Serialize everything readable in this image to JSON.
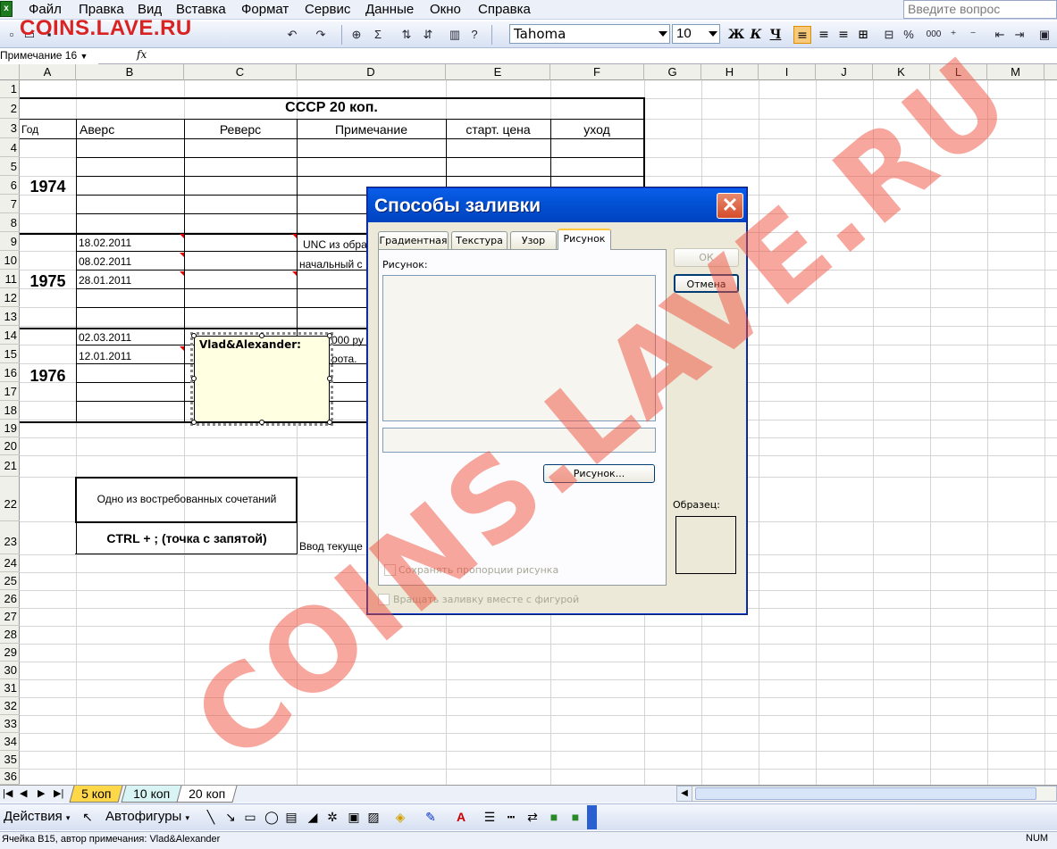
{
  "menu": {
    "items": [
      "Файл",
      "Правка",
      "Вид",
      "Вставка",
      "Формат",
      "Сервис",
      "Данные",
      "Окно",
      "Справка"
    ],
    "ask_placeholder": "Введите вопрос"
  },
  "logo_text": "COINS.LAVE.RU",
  "toolbar": {
    "font": "Tahoma",
    "size": "10",
    "bold": "Ж",
    "italic": "К",
    "underline": "Ч",
    "percent": "%",
    "thousands": "000",
    "sum": "Σ"
  },
  "formula": {
    "name_box": "Примечание 16",
    "fx": "fx"
  },
  "columns": [
    "A",
    "B",
    "C",
    "D",
    "E",
    "F",
    "G",
    "H",
    "I",
    "J",
    "K",
    "L",
    "M"
  ],
  "rows": [
    "1",
    "2",
    "3",
    "4",
    "5",
    "6",
    "7",
    "8",
    "9",
    "10",
    "11",
    "12",
    "13",
    "14",
    "15",
    "16",
    "17",
    "18",
    "19",
    "20",
    "21",
    "22",
    "23",
    "24",
    "25",
    "26",
    "27",
    "28",
    "29",
    "30",
    "31",
    "32",
    "33",
    "34",
    "35",
    "36"
  ],
  "sheet": {
    "title": "СССР  20 коп.",
    "headers": [
      "Год",
      "Аверс",
      "Реверс",
      "Примечание",
      "старт. цена",
      "уход"
    ],
    "years": [
      "1974",
      "1975",
      "1976"
    ],
    "b9": "18.02.2011",
    "b10": "08.02.2011",
    "b11": "28.01.2011",
    "d9": "UNC из обра",
    "d10": "начальный с",
    "b14": "02.03.2011",
    "b15": "12.01.2011",
    "d14": "000 ру",
    "d15": "рота.",
    "box1": "Одно из востребованных сочетаний",
    "box2": "CTRL  + ; (точка с запятой)",
    "d23": "Ввод текуще"
  },
  "comment": {
    "author": "Vlad&Alexander:"
  },
  "dialog": {
    "title": "Способы заливки",
    "tabs": [
      "Градиентная",
      "Текстура",
      "Узор",
      "Рисунок"
    ],
    "active_tab": "Рисунок",
    "picture_label": "Рисунок:",
    "ok": "ОК",
    "cancel": "Отмена",
    "picture_button": "Рисунок...",
    "sample_label": "Образец:",
    "keep_ratio": "Сохранять пропорции рисунка",
    "rotate_fill": "Вращать заливку вместе с фигурой"
  },
  "sheet_tabs": [
    "5 коп",
    "10 коп",
    "20 коп"
  ],
  "active_sheet": "20 коп",
  "drawbar": {
    "actions": "Действия",
    "autoshapes": "Автофигуры"
  },
  "status": {
    "text": "Ячейка B15, автор примечания: Vlad&Alexander",
    "num": "NUM"
  },
  "colors": {
    "comment_bg": "#ffffe1",
    "dialog_title": "#0a5ee8",
    "watermark": "#f0503c",
    "tab_5kop": "#ffd84a",
    "tab_10kop": "#d8f4f4"
  }
}
